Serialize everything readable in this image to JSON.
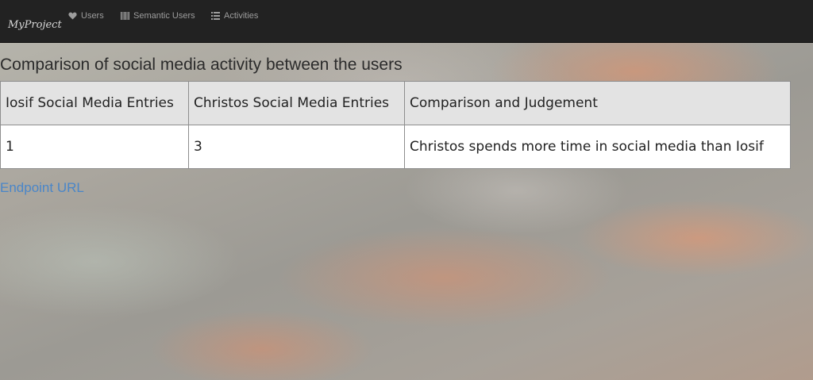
{
  "navbar": {
    "brand": "MyProject",
    "items": [
      {
        "label": "Users",
        "icon": "heart-icon"
      },
      {
        "label": "Semantic Users",
        "icon": "barcode-icon"
      },
      {
        "label": "Activities",
        "icon": "list-icon"
      }
    ]
  },
  "main": {
    "title": "Comparison of social media activity between the users",
    "table": {
      "headers": [
        "Iosif Social Media Entries",
        "Christos Social Media Entries",
        "Comparison and Judgement"
      ],
      "rows": [
        [
          "1",
          "3",
          "Christos spends more time in social media than Iosif"
        ]
      ]
    },
    "endpoint_link": "Endpoint URL"
  },
  "colors": {
    "navbar_bg": "#222222",
    "nav_text": "#9d9d9d",
    "link": "#4a86c8",
    "table_header_bg": "#e3e3e3"
  }
}
